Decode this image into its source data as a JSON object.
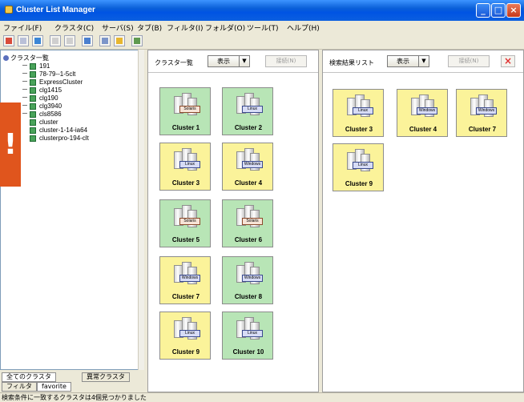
{
  "window": {
    "title": "Cluster List Manager"
  },
  "menu": [
    "ファイル(F)",
    "クラスタ(C)",
    "サーバ(S)",
    "タブ(B)",
    "フィルタ(I)",
    "フォルダ(O)",
    "ツール(T)",
    "ヘルプ(H)"
  ],
  "tree": {
    "root": "クラスタ一覧",
    "items": [
      "191",
      "78-79--1-5clt",
      "ExpressCluster",
      "clg1415",
      "clg190",
      "clg3940",
      "cls8586",
      "cluster",
      "cluster-1-14-ia64",
      "clusterpro-194-clt"
    ]
  },
  "left_tabs": {
    "row1": [
      "全てのクラスタ",
      "異常クラスタ"
    ],
    "row2": [
      "フィルタ",
      "favorite"
    ]
  },
  "cluster_pane": {
    "title": "クラスタ一覧",
    "show_label": "表示",
    "dropdown_glyph": "▼",
    "connect_label": "接続(N)",
    "tiles": [
      {
        "name": "Cluster 1",
        "os": "Solaris",
        "color": "green"
      },
      {
        "name": "Cluster 2",
        "os": "Linux",
        "color": "green"
      },
      {
        "name": "Cluster 3",
        "os": "Linux",
        "color": "yellow"
      },
      {
        "name": "Cluster 4",
        "os": "Windows",
        "color": "yellow"
      },
      {
        "name": "Cluster 5",
        "os": "Solaris",
        "color": "green"
      },
      {
        "name": "Cluster 6",
        "os": "Solaris",
        "color": "green"
      },
      {
        "name": "Cluster 7",
        "os": "Windows",
        "color": "yellow"
      },
      {
        "name": "Cluster 8",
        "os": "Windows",
        "color": "green"
      },
      {
        "name": "Cluster 9",
        "os": "Linux",
        "color": "yellow"
      },
      {
        "name": "Cluster 10",
        "os": "Linux",
        "color": "green"
      }
    ]
  },
  "search_pane": {
    "title": "検索結果リスト",
    "show_label": "表示",
    "dropdown_glyph": "▼",
    "connect_label": "接続(N)",
    "close_glyph": "×",
    "tiles": [
      {
        "name": "Cluster 3",
        "os": "Linux",
        "color": "yellow"
      },
      {
        "name": "Cluster 4",
        "os": "Windows",
        "color": "yellow"
      },
      {
        "name": "Cluster 7",
        "os": "Windows",
        "color": "yellow"
      },
      {
        "name": "Cluster 9",
        "os": "Linux",
        "color": "yellow"
      }
    ]
  },
  "status": "検索条件に一致するクラスタは4個見つかりました",
  "callout": {
    "glyph": "!"
  },
  "colors": {
    "green_tile": "#b8e5b6",
    "yellow_tile": "#fbf39a",
    "callout": "#e0551d",
    "titlebar": "#0054e3"
  }
}
